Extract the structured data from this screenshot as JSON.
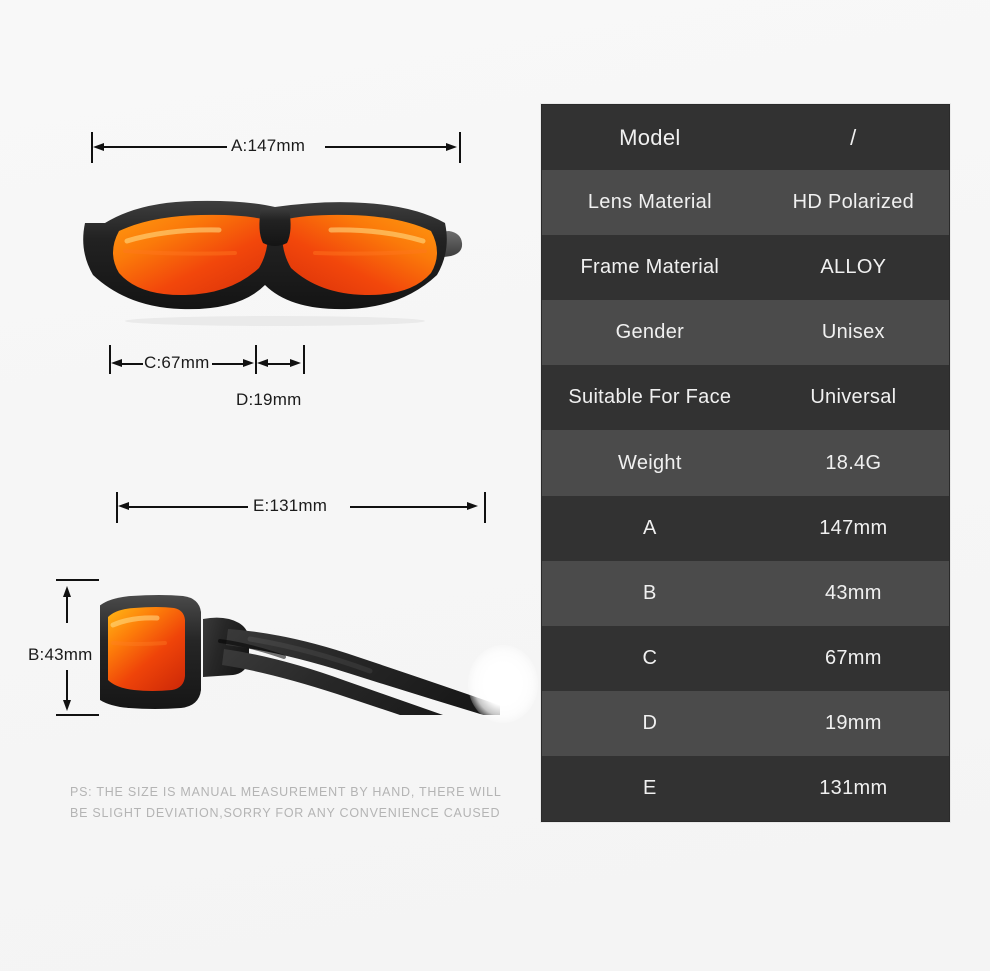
{
  "background_color": "#f7f7f7",
  "product": {
    "name": "polarized-sunglasses",
    "frame_color": "#262626",
    "lens_color": "#f4520c",
    "views": [
      "front-view",
      "side-view"
    ]
  },
  "dimensions": {
    "a": {
      "label": "A:147mm",
      "axis": "horizontal",
      "view": "front"
    },
    "b": {
      "label": "B:43mm",
      "axis": "vertical",
      "view": "side"
    },
    "c": {
      "label": "C:67mm",
      "axis": "horizontal",
      "view": "front"
    },
    "d": {
      "label": "D:19mm",
      "axis": "horizontal",
      "view": "front"
    },
    "e": {
      "label": "E:131mm",
      "axis": "horizontal",
      "view": "side"
    }
  },
  "disclaimer": {
    "line1": "PS: THE SIZE IS MANUAL MEASUREMENT BY HAND, THERE WILL",
    "line2": "BE SLIGHT DEVIATION,SORRY FOR ANY CONVENIENCE CAUSED"
  },
  "spec_table": {
    "row_color_odd": "#323232",
    "row_color_even": "#4b4b4b",
    "text_color": "#f0f0f0",
    "rows": [
      {
        "key": "Model",
        "value": "/"
      },
      {
        "key": "Lens Material",
        "value": "HD Polarized"
      },
      {
        "key": "Frame Material",
        "value": "ALLOY"
      },
      {
        "key": "Gender",
        "value": "Unisex"
      },
      {
        "key": "Suitable For Face",
        "value": "Universal"
      },
      {
        "key": "Weight",
        "value": "18.4G"
      },
      {
        "key": "A",
        "value": "147mm"
      },
      {
        "key": "B",
        "value": "43mm"
      },
      {
        "key": "C",
        "value": "67mm"
      },
      {
        "key": "D",
        "value": "19mm"
      },
      {
        "key": "E",
        "value": "131mm"
      }
    ]
  }
}
